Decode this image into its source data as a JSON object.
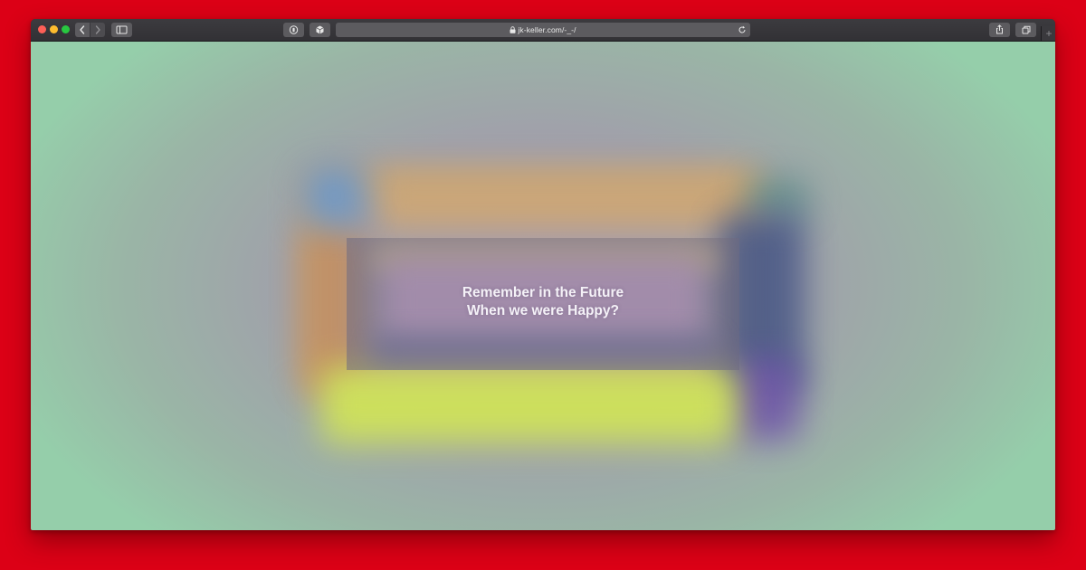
{
  "browser": {
    "address_bar": {
      "url": "jk-keller.com/-_-/"
    },
    "new_tab_label": "+"
  },
  "page": {
    "message_line1": "Remember in the Future",
    "message_line2": "When we were Happy?"
  },
  "icons": [
    "close-dot",
    "minimize-dot",
    "maximize-dot",
    "chevron-left-icon",
    "chevron-right-icon",
    "sidebar-icon",
    "privacy-report-icon",
    "extension-cube-icon",
    "lock-icon",
    "reload-icon",
    "share-icon",
    "tabs-overview-icon",
    "plus-icon"
  ],
  "colors": {
    "backdrop": "#dc0016",
    "toolbar": "#3c3b3f",
    "viewport_edge": "#95ceaa",
    "viewport_center": "#a59ab2",
    "message_text": "#f4f1f7"
  }
}
